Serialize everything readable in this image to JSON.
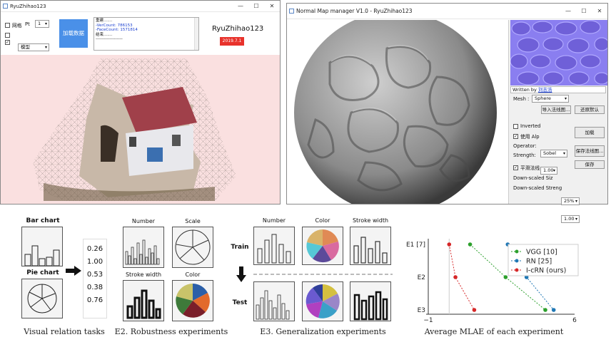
{
  "win1": {
    "title": "RyuZhihao123",
    "checkbox_grid": "网格",
    "pt_label": "Pt",
    "pt_value": "1",
    "dropdown_value": "模型",
    "load_button": "加载数据",
    "log_lines": [
      "重建.......",
      "-VerCount: 786153",
      "-FaceCount: 1571814",
      "结束.......",
      "-------------------"
    ],
    "author": "RyuZhihao123",
    "date_badge": "2019.7.1",
    "log_line_colors": [
      "#111111",
      "#1a3fd0",
      "#1a3fd0",
      "#111111",
      "#111111"
    ],
    "badge_color": "#e8322b",
    "load_button_color": "#4a90e8",
    "canvas_bg": "#fae0e0"
  },
  "win2": {
    "title": "Normal Map manager V1.0 - RyuZhihao123",
    "written_by_prefix": "Written by ",
    "written_by_name": "刘志浩",
    "mesh_label": "Mesh :",
    "mesh_value": "Sphere",
    "import_button": "导入法线图...",
    "restore_button": "还原默认",
    "inverted_label": "Inverted",
    "use_alpha_label": "使用 Alp",
    "operator_label": "Operator:",
    "operator_value": "Sobel",
    "strength_label": "Strength:",
    "strength_value": "1.00",
    "load_button": "加载",
    "save_normal_button": "保存法线图...",
    "save_button": "保存",
    "smooth_label": "平滑法线",
    "downscaled_size_label": "Down-scaled Siz",
    "downscaled_size_value": "25%",
    "downscaled_strength_label": "Down-scaled Streng",
    "downscaled_strength_value": "1.00"
  },
  "figure": {
    "bar_chart_label": "Bar chart",
    "pie_chart_label": "Pie chart",
    "values": [
      "0.26",
      "1.00",
      "0.53",
      "0.38",
      "0.76"
    ],
    "caption_visual": "Visual relation tasks",
    "e2_number": "Number",
    "e2_scale": "Scale",
    "e2_stroke": "Stroke width",
    "e2_color": "Color",
    "caption_e2": "E2. Robustness experiments",
    "e3_number": "Number",
    "e3_color": "Color",
    "e3_stroke": "Stroke width",
    "train_label": "Train",
    "test_label": "Test",
    "caption_e3": "E3. Generalization experiments",
    "caption_mlae": "Average MLAE of each experiment"
  },
  "chart_data": {
    "type": "scatter",
    "categories": [
      "E1 [7]",
      "E2",
      "E3"
    ],
    "xlim": [
      -1,
      6
    ],
    "x_tick_labels": [
      "−1",
      "6"
    ],
    "legend_position": "top-right",
    "series": [
      {
        "name": "VGG [10]",
        "color": "#2ca02c",
        "values": [
          1.0,
          2.7,
          4.6
        ]
      },
      {
        "name": "RN [25]",
        "color": "#1f77b4",
        "values": [
          2.8,
          3.7,
          5.0
        ]
      },
      {
        "name": "I-cRN (ours)",
        "color": "#d62728",
        "values": [
          0.0,
          0.3,
          1.2
        ]
      }
    ]
  }
}
